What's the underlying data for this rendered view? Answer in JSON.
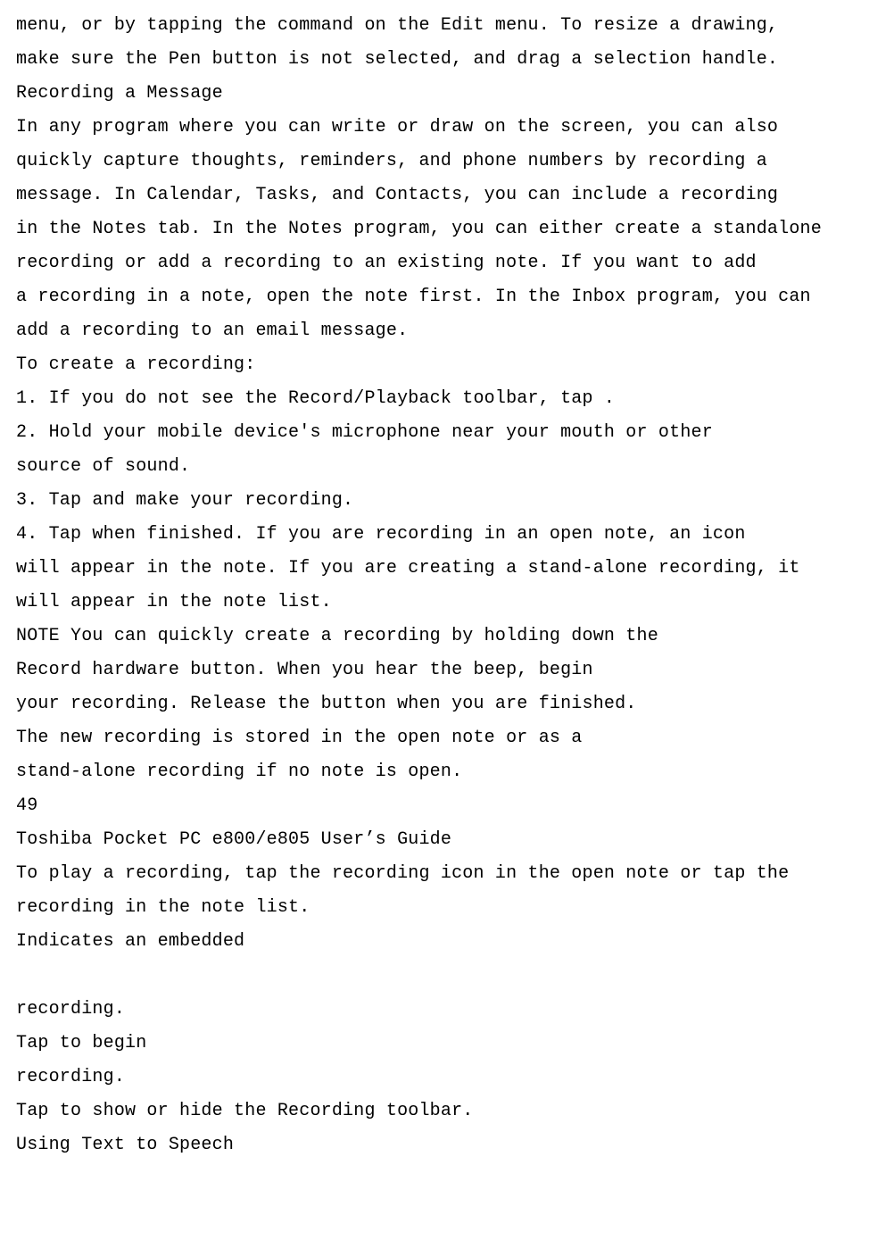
{
  "doc": {
    "lines": [
      "menu, or by tapping the command on the Edit menu. To resize a drawing,",
      "make sure the Pen button is not selected, and drag a selection handle.",
      "Recording a Message",
      "In any program where you can write or draw on the screen, you can also",
      "quickly capture thoughts, reminders, and phone numbers by recording a",
      "message. In Calendar, Tasks, and Contacts, you can include a recording",
      "in the Notes tab. In the Notes program, you can either create a standalone",
      "recording or add a recording to an existing note. If you want to add",
      "a recording in a note, open the note first. In the Inbox program, you can",
      "add a recording to an email message.",
      "To create a recording:",
      "1. If you do not see the Record/Playback toolbar, tap .",
      "2. Hold your mobile device's microphone near your mouth or other",
      "source of sound.",
      "3. Tap and make your recording.",
      "4. Tap when finished. If you are recording in an open note, an icon",
      "will appear in the note. If you are creating a stand-alone recording, it",
      "will appear in the note list.",
      "NOTE You can quickly create a recording by holding down the",
      "Record hardware button. When you hear the beep, begin",
      "your recording. Release the button when you are finished.",
      "The new recording is stored in the open note or as a",
      "stand-alone recording if no note is open.",
      "49",
      "Toshiba Pocket PC e800/e805 User’s Guide",
      "To play a recording, tap the recording icon in the open note or tap the",
      "recording in the note list.",
      "Indicates an embedded",
      "",
      "recording.",
      "Tap to begin",
      "recording.",
      "Tap to show or hide the Recording toolbar.",
      "Using Text to Speech"
    ]
  }
}
